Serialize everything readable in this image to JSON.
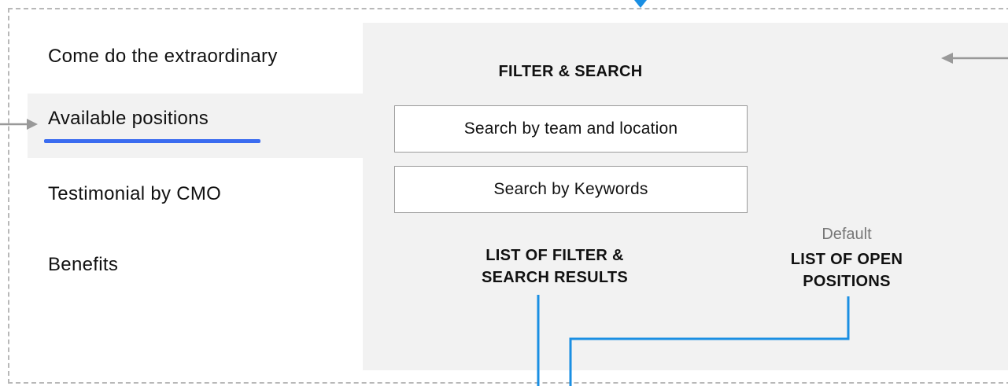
{
  "nav": {
    "items": [
      {
        "label": "Come do the extraordinary"
      },
      {
        "label": "Available positions",
        "active": true
      },
      {
        "label": "Testimonial by CMO"
      },
      {
        "label": "Benefits"
      }
    ],
    "accent_color": "#3b6cf0"
  },
  "panel": {
    "filter_heading": "FILTER & SEARCH",
    "search_team": {
      "label": "Search by team and location"
    },
    "search_keywords": {
      "label": "Search by Keywords"
    },
    "results_heading_line1": "LIST OF FILTER &",
    "results_heading_line2": "SEARCH RESULTS",
    "default_label": "Default",
    "open_positions_line1": "LIST OF OPEN",
    "open_positions_line2": "POSITIONS"
  },
  "colors": {
    "connector": "#1a8fe3",
    "arrow": "#999999",
    "panel_bg": "#f2f2f2",
    "frame": "#b8b8b8"
  }
}
